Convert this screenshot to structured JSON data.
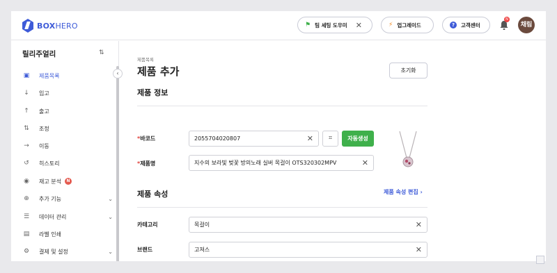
{
  "header": {
    "logo_bold": "BOX",
    "logo_light": "HERO",
    "team_setup": "팀 세팅 도우미",
    "upgrade": "업그레이드",
    "support": "고객센터",
    "notification_count": "N",
    "avatar": "채림"
  },
  "sidebar": {
    "workspace": "릴리주얼리",
    "items": [
      {
        "label": "제품목록",
        "icon": "box-icon"
      },
      {
        "label": "입고",
        "icon": "arrow-down-icon"
      },
      {
        "label": "출고",
        "icon": "arrow-up-icon"
      },
      {
        "label": "조정",
        "icon": "swap-icon"
      },
      {
        "label": "이동",
        "icon": "arrow-right-icon"
      },
      {
        "label": "히스토리",
        "icon": "history-icon"
      },
      {
        "label": "재고 분석",
        "icon": "eye-icon",
        "badge": "N"
      },
      {
        "label": "추가 기능",
        "icon": "plus-circle-icon"
      },
      {
        "label": "데이터 관리",
        "icon": "database-icon"
      },
      {
        "label": "라벨 인쇄",
        "icon": "label-icon"
      },
      {
        "label": "결제 및 설정",
        "icon": "gear-icon"
      }
    ]
  },
  "main": {
    "breadcrumb": "제품목록",
    "title": "제품 추가",
    "reset_label": "초기화",
    "info_section": "제품 정보",
    "barcode_label": "바코드",
    "barcode_value": "2055704020807",
    "auto_generate": "자동생성",
    "name_label": "제품명",
    "name_value": "지수의 보라빛 벚꽃 방의노래 실버 목걸이 OTS320302MPV",
    "attr_section": "제품 속성",
    "attr_edit": "제품 속성 편집 ›",
    "category_label": "카테고리",
    "category_value": "목걸이",
    "brand_label": "브랜드",
    "brand_value": "고져스",
    "required_mark": "*"
  },
  "colors": {
    "accent": "#3e5bd8",
    "primary_green": "#3fb04b",
    "required": "#e0413b"
  }
}
